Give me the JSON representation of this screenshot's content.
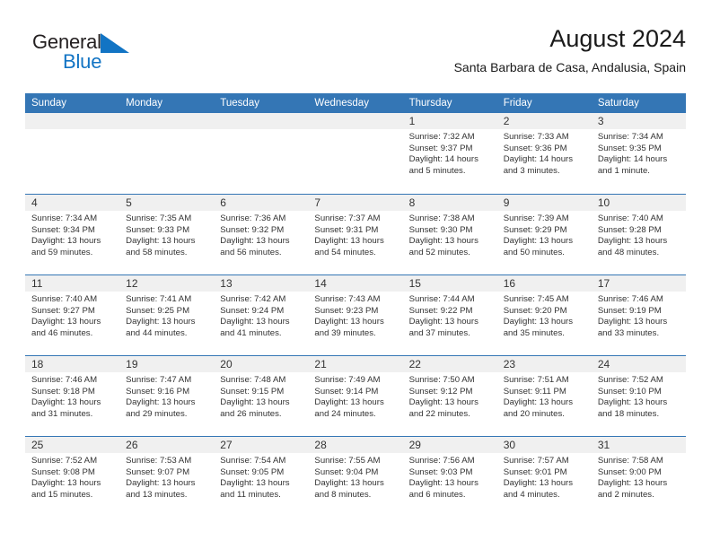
{
  "brand": {
    "name_part1": "General",
    "name_part2": "Blue",
    "triangle_icon": "triangle-icon",
    "accent_color": "#1274c4"
  },
  "header": {
    "title": "August 2024",
    "subtitle": "Santa Barbara de Casa, Andalusia, Spain"
  },
  "theme": {
    "header_bar_color": "#3476b5",
    "date_band_color": "#f0f0f0",
    "row_divider_color": "#3476b5"
  },
  "calendar": {
    "weekday_headers": [
      "Sunday",
      "Monday",
      "Tuesday",
      "Wednesday",
      "Thursday",
      "Friday",
      "Saturday"
    ],
    "weeks": [
      [
        {
          "blank": true
        },
        {
          "blank": true
        },
        {
          "blank": true
        },
        {
          "blank": true
        },
        {
          "day": "1",
          "sunrise": "Sunrise: 7:32 AM",
          "sunset": "Sunset: 9:37 PM",
          "daylight_l1": "Daylight: 14 hours",
          "daylight_l2": "and 5 minutes."
        },
        {
          "day": "2",
          "sunrise": "Sunrise: 7:33 AM",
          "sunset": "Sunset: 9:36 PM",
          "daylight_l1": "Daylight: 14 hours",
          "daylight_l2": "and 3 minutes."
        },
        {
          "day": "3",
          "sunrise": "Sunrise: 7:34 AM",
          "sunset": "Sunset: 9:35 PM",
          "daylight_l1": "Daylight: 14 hours",
          "daylight_l2": "and 1 minute."
        }
      ],
      [
        {
          "day": "4",
          "sunrise": "Sunrise: 7:34 AM",
          "sunset": "Sunset: 9:34 PM",
          "daylight_l1": "Daylight: 13 hours",
          "daylight_l2": "and 59 minutes."
        },
        {
          "day": "5",
          "sunrise": "Sunrise: 7:35 AM",
          "sunset": "Sunset: 9:33 PM",
          "daylight_l1": "Daylight: 13 hours",
          "daylight_l2": "and 58 minutes."
        },
        {
          "day": "6",
          "sunrise": "Sunrise: 7:36 AM",
          "sunset": "Sunset: 9:32 PM",
          "daylight_l1": "Daylight: 13 hours",
          "daylight_l2": "and 56 minutes."
        },
        {
          "day": "7",
          "sunrise": "Sunrise: 7:37 AM",
          "sunset": "Sunset: 9:31 PM",
          "daylight_l1": "Daylight: 13 hours",
          "daylight_l2": "and 54 minutes."
        },
        {
          "day": "8",
          "sunrise": "Sunrise: 7:38 AM",
          "sunset": "Sunset: 9:30 PM",
          "daylight_l1": "Daylight: 13 hours",
          "daylight_l2": "and 52 minutes."
        },
        {
          "day": "9",
          "sunrise": "Sunrise: 7:39 AM",
          "sunset": "Sunset: 9:29 PM",
          "daylight_l1": "Daylight: 13 hours",
          "daylight_l2": "and 50 minutes."
        },
        {
          "day": "10",
          "sunrise": "Sunrise: 7:40 AM",
          "sunset": "Sunset: 9:28 PM",
          "daylight_l1": "Daylight: 13 hours",
          "daylight_l2": "and 48 minutes."
        }
      ],
      [
        {
          "day": "11",
          "sunrise": "Sunrise: 7:40 AM",
          "sunset": "Sunset: 9:27 PM",
          "daylight_l1": "Daylight: 13 hours",
          "daylight_l2": "and 46 minutes."
        },
        {
          "day": "12",
          "sunrise": "Sunrise: 7:41 AM",
          "sunset": "Sunset: 9:25 PM",
          "daylight_l1": "Daylight: 13 hours",
          "daylight_l2": "and 44 minutes."
        },
        {
          "day": "13",
          "sunrise": "Sunrise: 7:42 AM",
          "sunset": "Sunset: 9:24 PM",
          "daylight_l1": "Daylight: 13 hours",
          "daylight_l2": "and 41 minutes."
        },
        {
          "day": "14",
          "sunrise": "Sunrise: 7:43 AM",
          "sunset": "Sunset: 9:23 PM",
          "daylight_l1": "Daylight: 13 hours",
          "daylight_l2": "and 39 minutes."
        },
        {
          "day": "15",
          "sunrise": "Sunrise: 7:44 AM",
          "sunset": "Sunset: 9:22 PM",
          "daylight_l1": "Daylight: 13 hours",
          "daylight_l2": "and 37 minutes."
        },
        {
          "day": "16",
          "sunrise": "Sunrise: 7:45 AM",
          "sunset": "Sunset: 9:20 PM",
          "daylight_l1": "Daylight: 13 hours",
          "daylight_l2": "and 35 minutes."
        },
        {
          "day": "17",
          "sunrise": "Sunrise: 7:46 AM",
          "sunset": "Sunset: 9:19 PM",
          "daylight_l1": "Daylight: 13 hours",
          "daylight_l2": "and 33 minutes."
        }
      ],
      [
        {
          "day": "18",
          "sunrise": "Sunrise: 7:46 AM",
          "sunset": "Sunset: 9:18 PM",
          "daylight_l1": "Daylight: 13 hours",
          "daylight_l2": "and 31 minutes."
        },
        {
          "day": "19",
          "sunrise": "Sunrise: 7:47 AM",
          "sunset": "Sunset: 9:16 PM",
          "daylight_l1": "Daylight: 13 hours",
          "daylight_l2": "and 29 minutes."
        },
        {
          "day": "20",
          "sunrise": "Sunrise: 7:48 AM",
          "sunset": "Sunset: 9:15 PM",
          "daylight_l1": "Daylight: 13 hours",
          "daylight_l2": "and 26 minutes."
        },
        {
          "day": "21",
          "sunrise": "Sunrise: 7:49 AM",
          "sunset": "Sunset: 9:14 PM",
          "daylight_l1": "Daylight: 13 hours",
          "daylight_l2": "and 24 minutes."
        },
        {
          "day": "22",
          "sunrise": "Sunrise: 7:50 AM",
          "sunset": "Sunset: 9:12 PM",
          "daylight_l1": "Daylight: 13 hours",
          "daylight_l2": "and 22 minutes."
        },
        {
          "day": "23",
          "sunrise": "Sunrise: 7:51 AM",
          "sunset": "Sunset: 9:11 PM",
          "daylight_l1": "Daylight: 13 hours",
          "daylight_l2": "and 20 minutes."
        },
        {
          "day": "24",
          "sunrise": "Sunrise: 7:52 AM",
          "sunset": "Sunset: 9:10 PM",
          "daylight_l1": "Daylight: 13 hours",
          "daylight_l2": "and 18 minutes."
        }
      ],
      [
        {
          "day": "25",
          "sunrise": "Sunrise: 7:52 AM",
          "sunset": "Sunset: 9:08 PM",
          "daylight_l1": "Daylight: 13 hours",
          "daylight_l2": "and 15 minutes."
        },
        {
          "day": "26",
          "sunrise": "Sunrise: 7:53 AM",
          "sunset": "Sunset: 9:07 PM",
          "daylight_l1": "Daylight: 13 hours",
          "daylight_l2": "and 13 minutes."
        },
        {
          "day": "27",
          "sunrise": "Sunrise: 7:54 AM",
          "sunset": "Sunset: 9:05 PM",
          "daylight_l1": "Daylight: 13 hours",
          "daylight_l2": "and 11 minutes."
        },
        {
          "day": "28",
          "sunrise": "Sunrise: 7:55 AM",
          "sunset": "Sunset: 9:04 PM",
          "daylight_l1": "Daylight: 13 hours",
          "daylight_l2": "and 8 minutes."
        },
        {
          "day": "29",
          "sunrise": "Sunrise: 7:56 AM",
          "sunset": "Sunset: 9:03 PM",
          "daylight_l1": "Daylight: 13 hours",
          "daylight_l2": "and 6 minutes."
        },
        {
          "day": "30",
          "sunrise": "Sunrise: 7:57 AM",
          "sunset": "Sunset: 9:01 PM",
          "daylight_l1": "Daylight: 13 hours",
          "daylight_l2": "and 4 minutes."
        },
        {
          "day": "31",
          "sunrise": "Sunrise: 7:58 AM",
          "sunset": "Sunset: 9:00 PM",
          "daylight_l1": "Daylight: 13 hours",
          "daylight_l2": "and 2 minutes."
        }
      ]
    ]
  }
}
